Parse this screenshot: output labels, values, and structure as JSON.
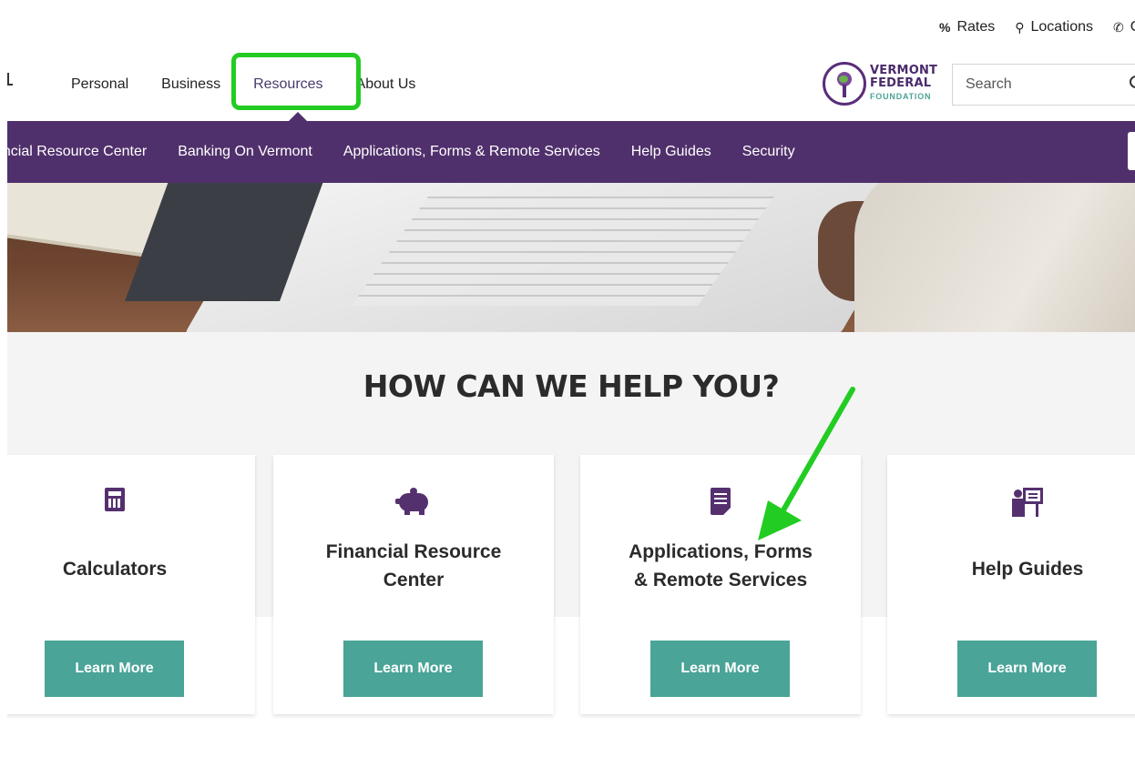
{
  "utility": {
    "rates": "Rates",
    "locations": "Locations",
    "contact_fragment": "C"
  },
  "logo": {
    "foundation_line1": "VERMONT",
    "foundation_line2": "FEDERAL",
    "foundation_line3": "FOUNDATION"
  },
  "mainnav": {
    "personal": "Personal",
    "business": "Business",
    "resources": "Resources",
    "about": "About Us"
  },
  "search": {
    "placeholder": "Search"
  },
  "subnav": {
    "items": [
      "ancial Resource Center",
      "Banking On Vermont",
      "Applications, Forms & Remote Services",
      "Help Guides",
      "Security"
    ]
  },
  "help": {
    "title": "HOW CAN WE HELP YOU?",
    "cards": [
      {
        "icon": "calculator-icon",
        "title": "Calculators",
        "button": "Learn More"
      },
      {
        "icon": "piggy-bank-icon",
        "title_line1": "Financial Resource",
        "title_line2": "Center",
        "button": "Learn More"
      },
      {
        "icon": "document-icon",
        "title_line1": "Applications, Forms",
        "title_line2": "& Remote Services",
        "button": "Learn More"
      },
      {
        "icon": "presentation-icon",
        "title": "Help Guides",
        "button": "Learn More"
      }
    ]
  },
  "colors": {
    "purple": "#50306c",
    "teal_button": "#4aa497",
    "annotation_green": "#22cc22"
  }
}
